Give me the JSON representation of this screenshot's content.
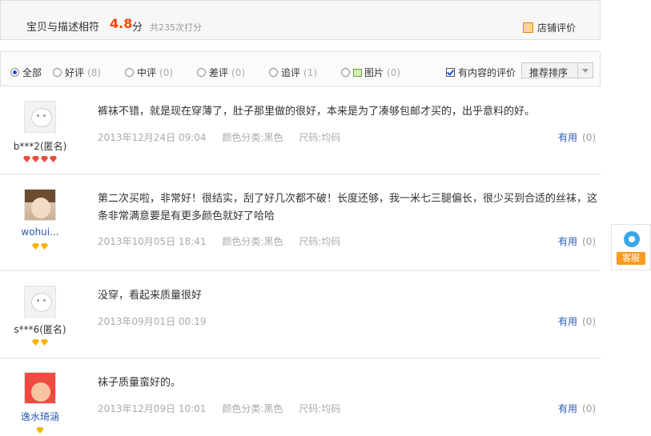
{
  "summary": {
    "desc_label": "宝贝与描述相符",
    "score": "4.8",
    "unit": "分",
    "count": "共235次打分",
    "shop_rating_link": "店铺评价"
  },
  "filters": {
    "options": [
      {
        "label": "全部",
        "count": ""
      },
      {
        "label": "好评",
        "count": "(8)"
      },
      {
        "label": "中评",
        "count": "(0)"
      },
      {
        "label": "差评",
        "count": "(0)"
      },
      {
        "label": "追评",
        "count": "(1)"
      },
      {
        "label": "图片",
        "count": "(0)"
      }
    ],
    "selected": "全部",
    "content_only": "有内容的评价",
    "sort_label": "推荐排序"
  },
  "reviews": [
    {
      "nickname": "b***2(匿名)",
      "content": "裤袜不错，就是现在穿薄了，肚子那里做的很好，本来是为了凑够包邮才买的，出乎意料的好。",
      "date": "2013年12月24日 09:04",
      "color": "颜色分类:黑色",
      "size": "尺码:均码",
      "useful_label": "有用",
      "useful_count": "(0)"
    },
    {
      "nickname": "wohui...",
      "content": "第二次买啦，非常好！很结实，刮了好几次都不破！长度还够，我一米七三腿偏长，很少买到合适的丝袜，这条非常满意要是有更多颜色就好了哈哈",
      "date": "2013年10月05日 18:41",
      "color": "颜色分类:黑色",
      "size": "尺码:均码",
      "useful_label": "有用",
      "useful_count": "(0)"
    },
    {
      "nickname": "s***6(匿名)",
      "content": "没穿，看起来质量很好",
      "date": "2013年09月01日 00:19",
      "color": "",
      "size": "",
      "useful_label": "有用",
      "useful_count": "(0)"
    },
    {
      "nickname": "逸水琦涵",
      "content": "袜子质量蛮好的。",
      "date": "2013年12月09日 10:01",
      "color": "颜色分类:黑色",
      "size": "尺码:均码",
      "useful_label": "有用",
      "useful_count": "(0)"
    }
  ],
  "service": {
    "label": "客服"
  }
}
